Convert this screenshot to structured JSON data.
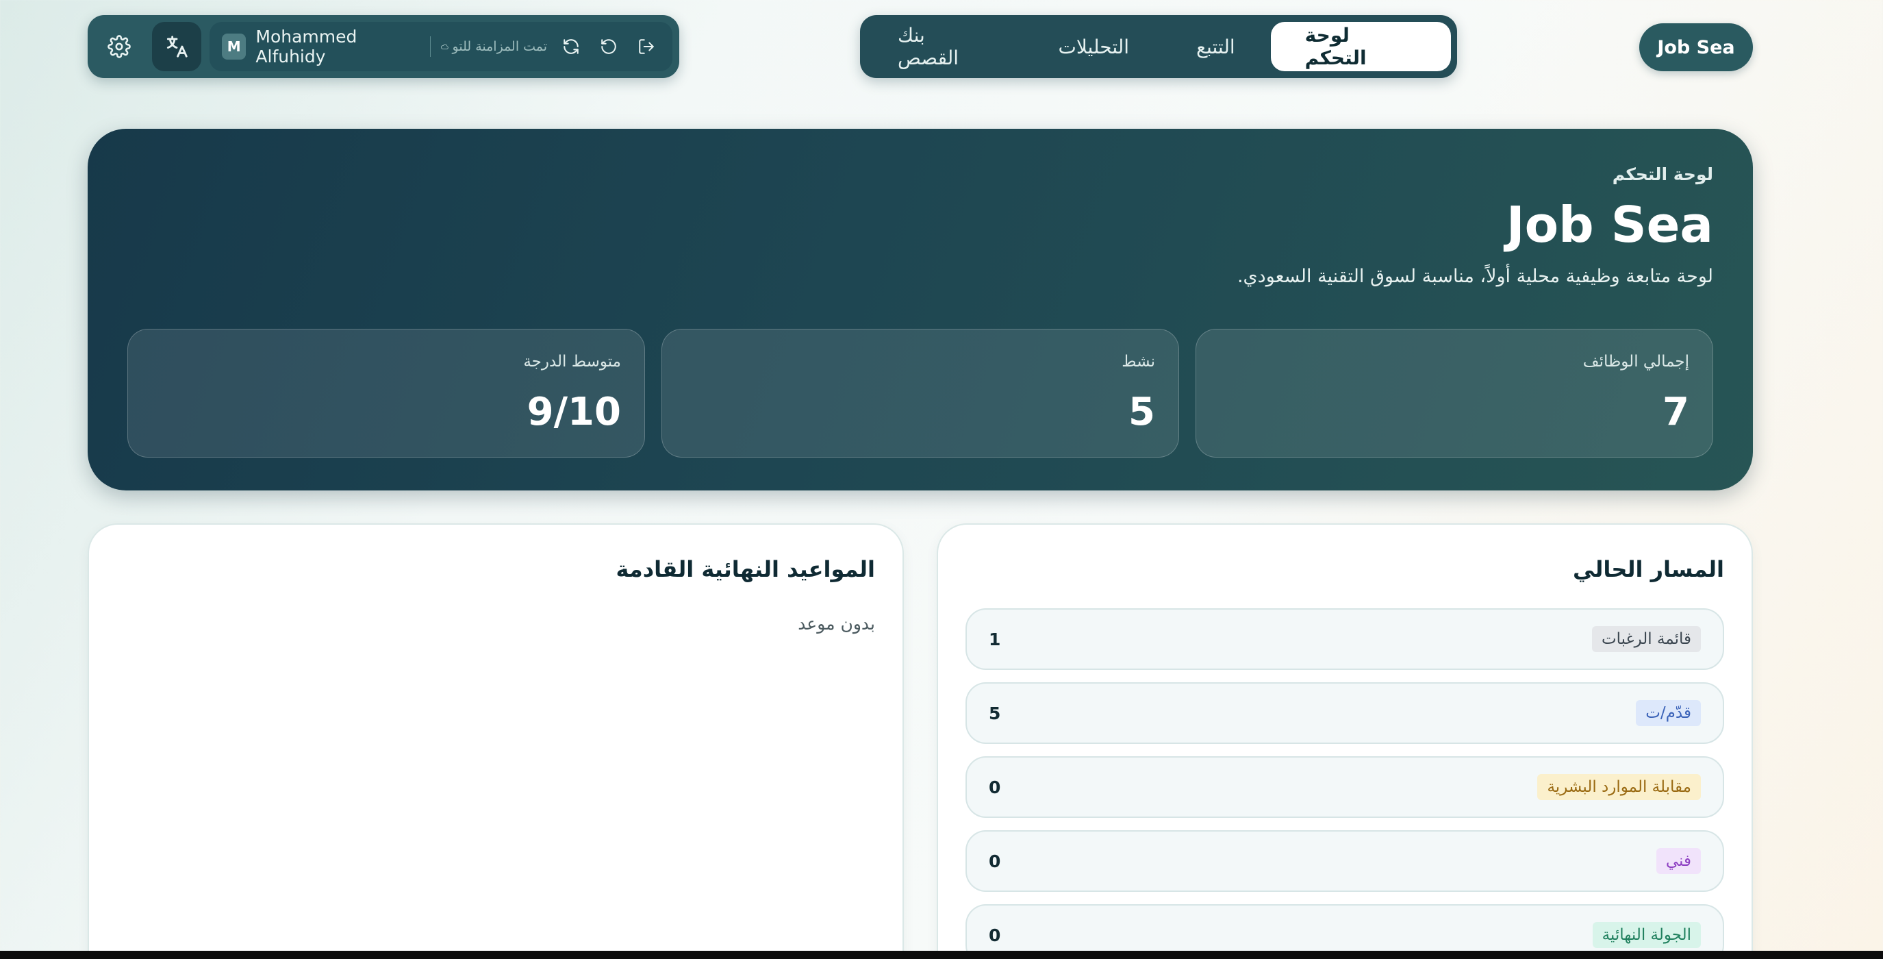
{
  "brand": {
    "label": "Job Sea"
  },
  "nav": {
    "tabs": [
      {
        "label": "لوحة التحكم",
        "active": true
      },
      {
        "label": "التتبع",
        "active": false
      },
      {
        "label": "التحليلات",
        "active": false
      },
      {
        "label": "بنك القصص",
        "active": false
      }
    ]
  },
  "toolbar": {
    "settings_icon": "gear-icon",
    "language_icon": "translate-icon",
    "user_initial": "M",
    "user_name": "Mohammed Alfuhidy",
    "sync_status": "تمت المزامنة للتو",
    "sync_icon": "refresh-icon",
    "undo_icon": "undo-icon",
    "logout_icon": "logout-icon"
  },
  "hero": {
    "kicker": "لوحة التحكم",
    "title": "Job Sea",
    "subtitle": "لوحة متابعة وظيفية محلية أولاً، مناسبة لسوق التقنية السعودي.",
    "stats": [
      {
        "label": "إجمالي الوظائف",
        "value": "7"
      },
      {
        "label": "نشط",
        "value": "5"
      },
      {
        "label": "متوسط الدرجة",
        "value": "9/10"
      }
    ]
  },
  "pipeline": {
    "title": "المسار الحالي",
    "stages": [
      {
        "label": "قائمة الرغبات",
        "count": "1",
        "color": "#e5e7ea"
      },
      {
        "label": "قدّم/ت",
        "count": "5",
        "color": "#dde8fb"
      },
      {
        "label": "مقابلة الموارد البشرية",
        "count": "0",
        "color": "#fbf0cc"
      },
      {
        "label": "فني",
        "count": "0",
        "color": "#f1e3fb"
      },
      {
        "label": "الجولة النهائية",
        "count": "0",
        "color": "#d8f4ea"
      }
    ]
  },
  "deadlines": {
    "title": "المواعيد النهائية القادمة",
    "empty": "بدون موعد"
  }
}
